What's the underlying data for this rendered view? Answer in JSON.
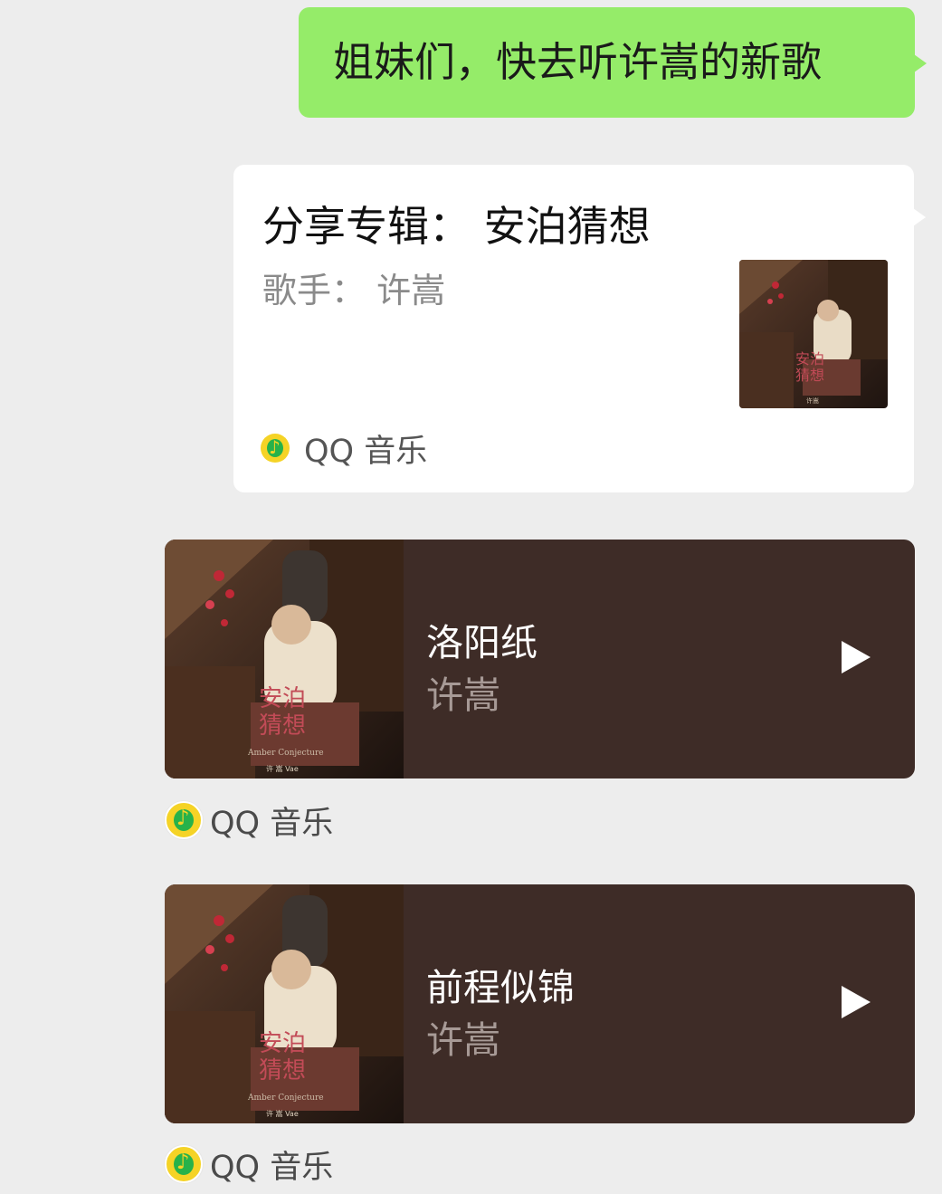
{
  "messages": {
    "text_message": "姐妹们，快去听许嵩的新歌",
    "album_share": {
      "title": "分享专辑：  安泊猜想",
      "artist": "歌手：  许嵩",
      "source": "QQ 音乐",
      "cover_text": {
        "line1": "安泊",
        "line2": "猜想",
        "artist": "许嵩"
      }
    },
    "music_cards": [
      {
        "song": "洛阳纸",
        "singer": "许嵩",
        "source": "QQ 音乐",
        "cover_text": {
          "line1": "安泊",
          "line2": "猜想",
          "subtitle": "Amber Conjecture",
          "artist": "许 嵩 Vae"
        }
      },
      {
        "song": "前程似锦",
        "singer": "许嵩",
        "source": "QQ 音乐",
        "cover_text": {
          "line1": "安泊",
          "line2": "猜想",
          "subtitle": "Amber Conjecture",
          "artist": "许 嵩 Vae"
        }
      }
    ]
  },
  "colors": {
    "background": "#ededed",
    "sent_bubble": "#95ec69",
    "card_white": "#ffffff",
    "music_card": "#3e2c27",
    "qq_music_yellow": "#f5d326",
    "qq_music_green": "#27b24a"
  },
  "icons": {
    "play": "play-icon",
    "source_logo": "qq-music-logo-icon"
  }
}
